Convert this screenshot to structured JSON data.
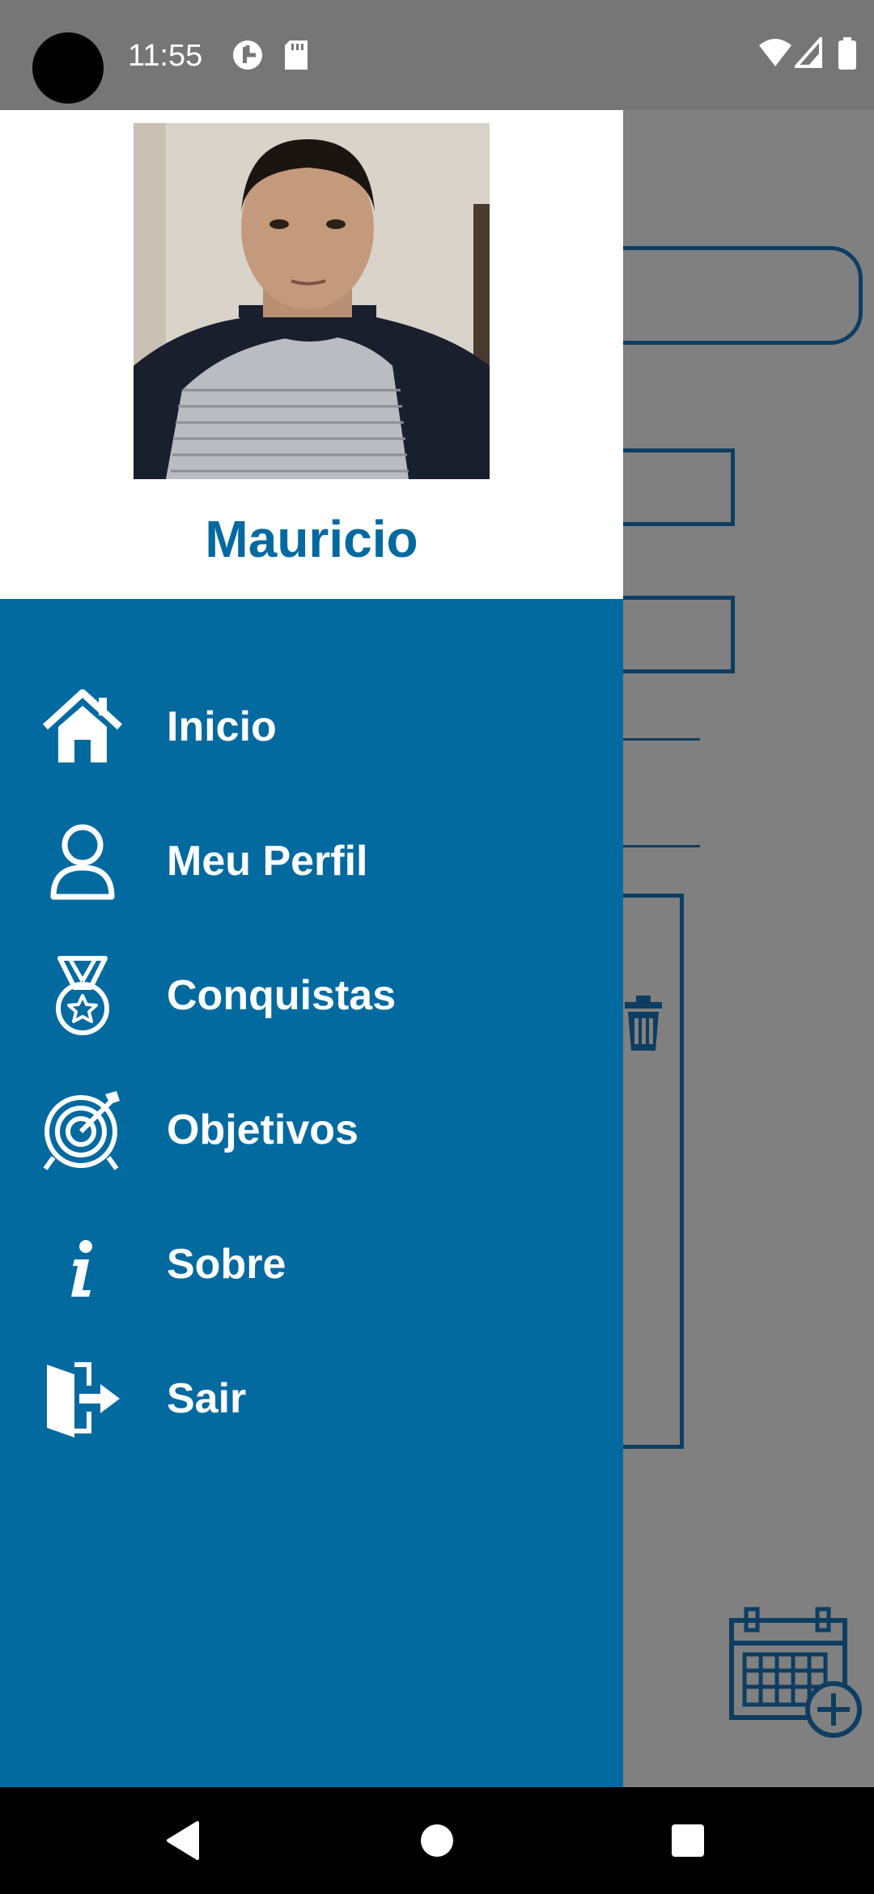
{
  "status_bar": {
    "time": "11:55",
    "icons": [
      "camera-cutout",
      "data-saver-icon",
      "sd-card-icon",
      "wifi-icon",
      "signal-icon",
      "battery-icon"
    ]
  },
  "drawer": {
    "user_name": "Mauricio",
    "items": [
      {
        "label": "Inicio",
        "icon": "home-icon"
      },
      {
        "label": "Meu Perfil",
        "icon": "user-icon"
      },
      {
        "label": "Conquistas",
        "icon": "medal-icon"
      },
      {
        "label": "Objetivos",
        "icon": "target-icon"
      },
      {
        "label": "Sobre",
        "icon": "info-icon"
      },
      {
        "label": "Sair",
        "icon": "logout-icon"
      }
    ]
  },
  "background_screen": {
    "icons": [
      "trash-icon",
      "calendar-add-icon"
    ]
  },
  "nav_bar": {
    "buttons": [
      "back",
      "home",
      "recents"
    ]
  },
  "colors": {
    "drawer_blue": "#036aa0",
    "scrim": "#808080",
    "outline": "#0d3e62"
  }
}
